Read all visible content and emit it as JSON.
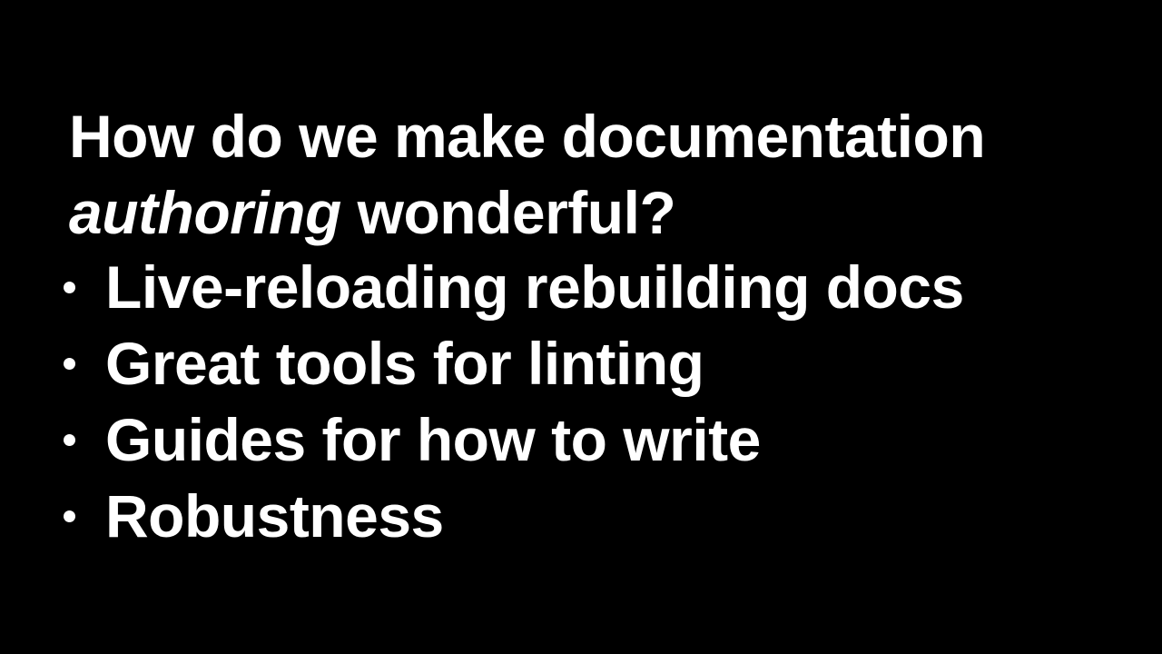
{
  "heading": {
    "line1": "How do we make documentation",
    "line2_italic": "authoring",
    "line2_rest": " wonderful?"
  },
  "bullets": [
    {
      "text": "Live-reloading rebuilding docs"
    },
    {
      "text": "Great tools for linting"
    },
    {
      "text": "Guides for how to write"
    },
    {
      "text": "Robustness"
    }
  ],
  "colors": {
    "background": "#000000",
    "text": "#ffffff"
  }
}
